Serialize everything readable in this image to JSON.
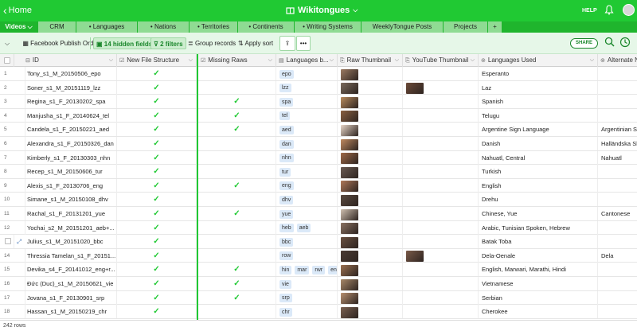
{
  "topbar": {
    "home_label": "Home",
    "base_name": "Wikitongues",
    "help_label": "HELP"
  },
  "tabs": [
    {
      "label": "Videos ⌵",
      "active": true
    },
    {
      "label": "CRM"
    },
    {
      "label": "• Languages"
    },
    {
      "label": "• Nations"
    },
    {
      "label": "• Territories"
    },
    {
      "label": "• Continents"
    },
    {
      "label": "• Writing Systems"
    },
    {
      "label": "WeeklyTongue Posts"
    },
    {
      "label": "Projects"
    },
    {
      "label": "+"
    }
  ],
  "toolbar": {
    "view_name": "Facebook Publish Order",
    "hidden_fields": "14 hidden fields",
    "filters": "2 filters",
    "group": "Group records",
    "sort": "Apply sort",
    "share": "SHARE"
  },
  "columns": [
    "ID",
    "New File Structure",
    "Missing Raws",
    "Languages b...",
    "Raw Thumbnail",
    "YouTube Thumbnail",
    "Languages Used",
    "Alternate N"
  ],
  "rows": [
    {
      "n": "1",
      "id": "Tony_s1_M_20150506_epo",
      "nfs": "✓",
      "raw": "",
      "tags": [
        "epo"
      ],
      "rt": "#9c7b62",
      "yt": "",
      "lang": "Esperanto",
      "alt": ""
    },
    {
      "n": "2",
      "id": "Soner_s1_M_20151119_lzz",
      "nfs": "✓",
      "raw": "",
      "tags": [
        "lzz"
      ],
      "rt": "#7a6a5c",
      "yt": "#6b4a38",
      "lang": "Laz",
      "alt": ""
    },
    {
      "n": "3",
      "id": "Regina_s1_F_20130202_spa",
      "nfs": "✓",
      "raw": "✓",
      "tags": [
        "spa"
      ],
      "rt": "#b98c5e",
      "yt": "",
      "lang": "Spanish",
      "alt": ""
    },
    {
      "n": "4",
      "id": "Manjusha_s1_F_20140624_tel",
      "nfs": "✓",
      "raw": "✓",
      "tags": [
        "tel"
      ],
      "rt": "#8a6040",
      "yt": "",
      "lang": "Telugu",
      "alt": ""
    },
    {
      "n": "5",
      "id": "Candela_s1_F_20150221_aed",
      "nfs": "✓",
      "raw": "✓",
      "tags": [
        "aed"
      ],
      "rt": "#e8d6c8",
      "yt": "",
      "lang": "Argentine Sign Language",
      "alt": "Argentinian Si"
    },
    {
      "n": "6",
      "id": "Alexandra_s1_F_20150326_dan",
      "nfs": "✓",
      "raw": "",
      "tags": [
        "dan"
      ],
      "rt": "#c08a60",
      "yt": "",
      "lang": "Danish",
      "alt": "Halländska Sk"
    },
    {
      "n": "7",
      "id": "Kimberly_s1_F_20130303_nhn",
      "nfs": "✓",
      "raw": "",
      "tags": [
        "nhn"
      ],
      "rt": "#a06a48",
      "yt": "",
      "lang": "Nahuatl, Central",
      "alt": "Nahuatl"
    },
    {
      "n": "8",
      "id": "Recep_s1_M_20150606_tur",
      "nfs": "✓",
      "raw": "",
      "tags": [
        "tur"
      ],
      "rt": "#6a5a52",
      "yt": "",
      "lang": "Turkish",
      "alt": ""
    },
    {
      "n": "9",
      "id": "Alexis_s1_F_20130706_eng",
      "nfs": "✓",
      "raw": "✓",
      "tags": [
        "eng"
      ],
      "rt": "#b07858",
      "yt": "",
      "lang": "English",
      "alt": ""
    },
    {
      "n": "10",
      "id": "Simane_s1_M_20150108_dhv",
      "nfs": "✓",
      "raw": "",
      "tags": [
        "dhv"
      ],
      "rt": "#5a4a40",
      "yt": "",
      "lang": "Drehu",
      "alt": ""
    },
    {
      "n": "11",
      "id": "Rachal_s1_F_20131201_yue",
      "nfs": "✓",
      "raw": "✓",
      "tags": [
        "yue"
      ],
      "rt": "#d0c0b0",
      "yt": "",
      "lang": "Chinese, Yue",
      "alt": "Cantonese"
    },
    {
      "n": "12",
      "id": "Yochai_s2_M_20151201_aeb+...",
      "nfs": "✓",
      "raw": "",
      "tags": [
        "heb",
        "aeb"
      ],
      "rt": "#8a7262",
      "yt": "",
      "lang": "Arabic, Tunisian Spoken, Hebrew",
      "alt": ""
    },
    {
      "n": "",
      "id": "Julius_s1_M_20151020_bbc",
      "nfs": "✓",
      "raw": "",
      "tags": [
        "bbc"
      ],
      "rt": "#6a5040",
      "yt": "",
      "lang": "Batak Toba",
      "alt": ""
    },
    {
      "n": "14",
      "id": "Thressia Tamelan_s1_F_20151...",
      "nfs": "✓",
      "raw": "",
      "tags": [
        "row"
      ],
      "rt": "#4a3a32",
      "yt": "#7a5a48",
      "lang": "Dela-Oenale",
      "alt": "Dela"
    },
    {
      "n": "15",
      "id": "Devika_s4_F_20141012_eng+r...",
      "nfs": "✓",
      "raw": "✓",
      "tags": [
        "hin",
        "mar",
        "rwr",
        "eng"
      ],
      "rt": "#9a7050",
      "yt": "",
      "lang": "English, Marwari, Marathi, Hindi",
      "alt": ""
    },
    {
      "n": "16",
      "id": "Đức (Duc)_s1_M_20150621_vie",
      "nfs": "✓",
      "raw": "✓",
      "tags": [
        "vie"
      ],
      "rt": "#a88868",
      "yt": "",
      "lang": "Vietnamese",
      "alt": ""
    },
    {
      "n": "17",
      "id": "Jovana_s1_F_20130901_srp",
      "nfs": "✓",
      "raw": "✓",
      "tags": [
        "srp"
      ],
      "rt": "#b89070",
      "yt": "",
      "lang": "Serbian",
      "alt": ""
    },
    {
      "n": "18",
      "id": "Hassan_s1_M_20150219_chr",
      "nfs": "✓",
      "raw": "",
      "tags": [
        "chr"
      ],
      "rt": "#7a6050",
      "yt": "",
      "lang": "Cherokee",
      "alt": ""
    }
  ],
  "footer": {
    "row_count": "242 rows"
  }
}
